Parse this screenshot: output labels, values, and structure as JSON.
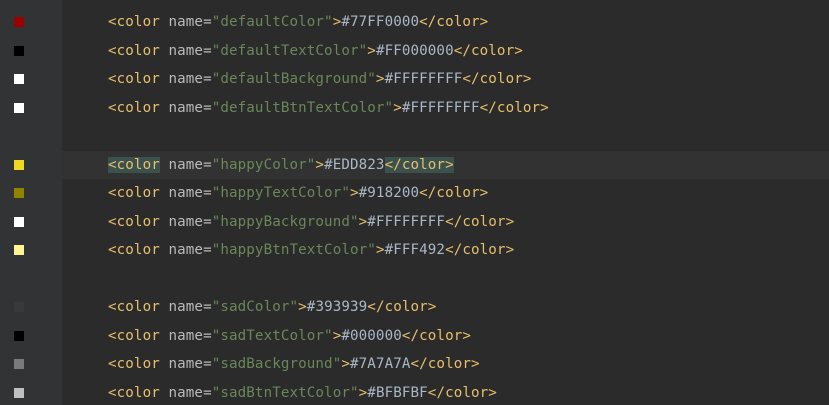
{
  "lines": [
    {
      "name": "defaultColor",
      "value": "#77FF0000",
      "swatch": "#990000",
      "blank": false
    },
    {
      "name": "defaultTextColor",
      "value": "#FF000000",
      "swatch": "#000000",
      "blank": false
    },
    {
      "name": "defaultBackground",
      "value": "#FFFFFFFF",
      "swatch": "#ffffff",
      "blank": false
    },
    {
      "name": "defaultBtnTextColor",
      "value": "#FFFFFFFF",
      "swatch": "#ffffff",
      "blank": false
    },
    {
      "blank": true
    },
    {
      "name": "happyColor",
      "value": "#EDD823",
      "swatch": "#EDD823",
      "blank": false,
      "current": true
    },
    {
      "name": "happyTextColor",
      "value": "#918200",
      "swatch": "#918200",
      "blank": false
    },
    {
      "name": "happyBackground",
      "value": "#FFFFFFFF",
      "swatch": "#ffffff",
      "blank": false
    },
    {
      "name": "happyBtnTextColor",
      "value": "#FFF492",
      "swatch": "#FFF492",
      "blank": false
    },
    {
      "blank": true
    },
    {
      "name": "sadColor",
      "value": "#393939",
      "swatch": "#393939",
      "blank": false
    },
    {
      "name": "sadTextColor",
      "value": "#000000",
      "swatch": "#000000",
      "blank": false
    },
    {
      "name": "sadBackground",
      "value": "#7A7A7A",
      "swatch": "#7A7A7A",
      "blank": false
    },
    {
      "name": "sadBtnTextColor",
      "value": "#BFBFBF",
      "swatch": "#BFBFBF",
      "blank": false
    }
  ],
  "syntax": {
    "open_tag": "<color",
    "attr_name": " name=",
    "close_tag": "</color>",
    "gt": ">"
  }
}
